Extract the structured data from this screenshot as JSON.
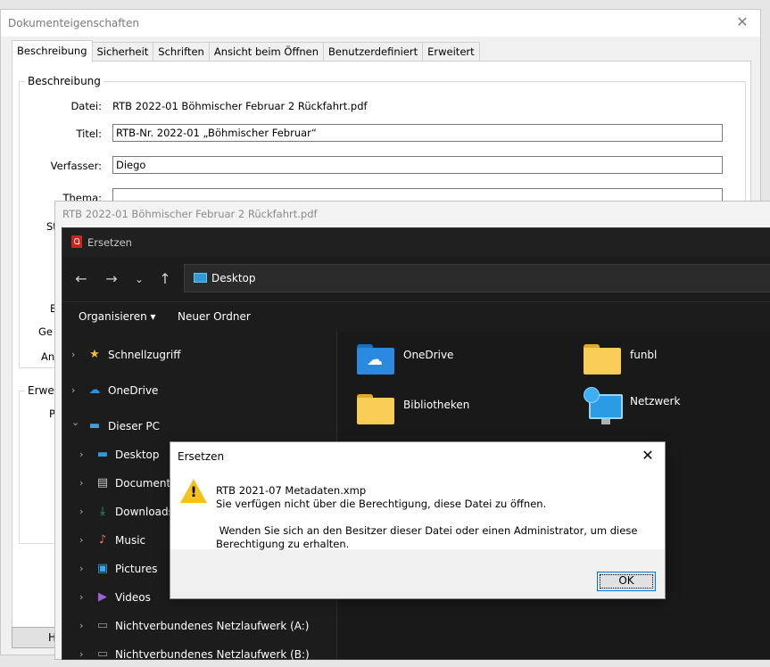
{
  "docprops": {
    "title": "Dokumenteigenschaften",
    "close_label": "✕",
    "tabs": [
      "Beschreibung",
      "Sicherheit",
      "Schriften",
      "Ansicht beim Öffnen",
      "Benutzerdefiniert",
      "Erweitert"
    ],
    "active_tab": "Beschreibung",
    "group_description": "Beschreibung",
    "fields": {
      "file_label": "Datei:",
      "file_value": "RTB 2022-01 Böhmischer Februar 2 Rückfahrt.pdf",
      "title_label": "Titel:",
      "title_value": "RTB-Nr. 2022-01 „Böhmischer Februar“",
      "author_label": "Verfasser:",
      "author_value": "Diego",
      "subject_label": "Thema:",
      "subject_value": ""
    },
    "partial_labels": [
      "St",
      "E",
      "Ge",
      "An"
    ],
    "group_advanced_partial": "Erweit",
    "partial_label_p": "P",
    "bottom_button_partial": "H"
  },
  "acrobat_window": {
    "title": "RTB 2022-01 Böhmischer Februar 2 Rückfahrt.pdf"
  },
  "file_dialog": {
    "title": "Ersetzen",
    "location": "Desktop",
    "commands": {
      "organize": "Organisieren",
      "organize_arrow": "▾",
      "new_folder": "Neuer Ordner"
    },
    "nav_items": [
      {
        "label": "Schnellzugriff",
        "icon": "star-icon",
        "glyph": "★",
        "color": "#f2c12e",
        "chevron": "›"
      },
      {
        "label": "OneDrive",
        "icon": "cloud-icon",
        "glyph": "☁",
        "color": "#2f8fdf",
        "chevron": "›"
      },
      {
        "label": "Dieser PC",
        "icon": "computer-icon",
        "glyph": "▬",
        "color": "#3aa0e0",
        "chevron": "⌄"
      },
      {
        "label": "Desktop",
        "icon": "desktop-icon",
        "glyph": "▬",
        "color": "#2e9ad8",
        "chevron": "›"
      },
      {
        "label": "Documents",
        "icon": "document-icon",
        "glyph": "▤",
        "color": "#c8c8c8",
        "chevron": "›"
      },
      {
        "label": "Downloads",
        "icon": "download-icon",
        "glyph": "⤓",
        "color": "#29b36b",
        "chevron": "›"
      },
      {
        "label": "Music",
        "icon": "music-icon",
        "glyph": "♪",
        "color": "#e8795a",
        "chevron": "›"
      },
      {
        "label": "Pictures",
        "icon": "pictures-icon",
        "glyph": "▣",
        "color": "#3aa7e8",
        "chevron": "›"
      },
      {
        "label": "Videos",
        "icon": "video-icon",
        "glyph": "▶",
        "color": "#9a63d8",
        "chevron": "›"
      },
      {
        "label": "Nichtverbundenes Netzlaufwerk (A:)",
        "icon": "network-drive-icon",
        "glyph": "▭",
        "color": "#9a9a9a",
        "chevron": "›"
      },
      {
        "label": "Nichtverbundenes Netzlaufwerk (B:)",
        "icon": "network-drive-icon",
        "glyph": "▭",
        "color": "#9a9a9a",
        "chevron": "›"
      }
    ],
    "tiles": [
      {
        "label": "OneDrive",
        "icon": "onedrive-folder-icon"
      },
      {
        "label": "funbl",
        "icon": "folder-icon"
      },
      {
        "label": "Bibliotheken",
        "icon": "libraries-folder-icon"
      },
      {
        "label": "Netzwerk",
        "icon": "network-icon"
      }
    ]
  },
  "message_box": {
    "title": "Ersetzen",
    "close_label": "✕",
    "filename": "RTB 2021-07 Metadaten.xmp",
    "line1": "Sie verfügen nicht über die Berechtigung, diese Datei zu öffnen.",
    "line2": " Wenden Sie sich an den Besitzer dieser Datei oder einen Administrator, um diese",
    "line3": "Berechtigung zu erhalten.",
    "ok_label": "OK",
    "warn_mark": "!"
  },
  "colors": {
    "dialog_dark": "#202020",
    "warning_yellow": "#f5c21b",
    "accent_blue": "#0078d7",
    "folder_yellow": "#f8cc55"
  }
}
